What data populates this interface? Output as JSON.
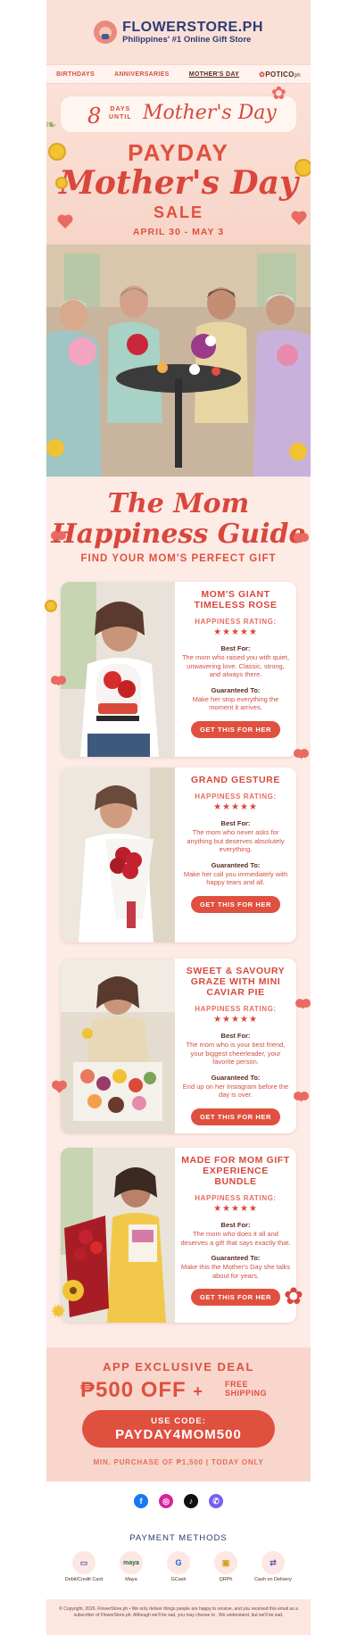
{
  "header": {
    "brand": "FLOWERSTORE.PH",
    "tagline": "Philippines' #1 Online Gift Store"
  },
  "nav": {
    "items": [
      "BIRTHDAYS",
      "ANNIVERSARIES",
      "MOTHER'S DAY"
    ],
    "potico": "POTICO",
    "potico_suffix": "ph"
  },
  "hero": {
    "countdown_number": "8",
    "countdown_unit": "DAYS",
    "countdown_until": "UNTIL",
    "countdown_script": "Mother's Day",
    "payday": "PAYDAY",
    "script": "Mother's Day",
    "sale": "SALE",
    "dates": "APRIL 30 - MAY 3"
  },
  "guide": {
    "line1": "The Mom",
    "line2": "Happiness Guide",
    "subtitle": "FIND YOUR MOM'S PERFECT GIFT"
  },
  "products": [
    {
      "title": "MOM'S GIANT TIMELESS ROSE",
      "rating_label": "HAPPINESS RATING:",
      "stars": "★★★★★",
      "best_for_label": "Best For:",
      "best_for": "The mom who raised you with quiet, unwavering love. Classic, strong, and always there.",
      "guaranteed_label": "Guaranteed To:",
      "guaranteed": "Make her stop everything the moment it arrives.",
      "cta": "GET THIS FOR HER"
    },
    {
      "title": "GRAND GESTURE",
      "rating_label": "HAPPINESS RATING:",
      "stars": "★★★★★",
      "best_for_label": "Best For:",
      "best_for": "The mom who never asks for anything but deserves absolutely everything.",
      "guaranteed_label": "Guaranteed To:",
      "guaranteed": "Make her call you immediately with happy tears and all.",
      "cta": "GET THIS FOR HER"
    },
    {
      "title": "SWEET & SAVOURY GRAZE WITH MINI CAVIAR PIE",
      "rating_label": "HAPPINESS RATING:",
      "stars": "★★★★★",
      "best_for_label": "Best For:",
      "best_for": "The mom who is your best friend, your biggest cheerleader, your favorite person.",
      "guaranteed_label": "Guaranteed To:",
      "guaranteed": "End up on her Instagram before the day is over.",
      "cta": "GET THIS FOR HER"
    },
    {
      "title": "MADE FOR MOM GIFT EXPERIENCE BUNDLE",
      "rating_label": "HAPPINESS RATING:",
      "stars": "★★★★★",
      "best_for_label": "Best For:",
      "best_for": "The mom who does it all and deserves a gift that says exactly that.",
      "guaranteed_label": "Guaranteed To:",
      "guaranteed": "Make this the Mother's Day she talks about for years.",
      "cta": "GET THIS FOR HER"
    }
  ],
  "deal": {
    "title": "APP EXCLUSIVE DEAL",
    "amount": "₱500 OFF",
    "plus": "+",
    "free_line1": "FREE",
    "free_line2": "SHIPPING",
    "code_label": "USE CODE:",
    "code": "PAYDAY4MOM500",
    "terms": "MIN. PURCHASE OF ₱1,500 | TODAY ONLY"
  },
  "footer": {
    "payment_title": "PAYMENT METHODS",
    "payments": [
      "Debit/Credit Card",
      "Maya",
      "GCash",
      "QRPh",
      "Cash on Delivery"
    ],
    "payment_glyphs": [
      "▭",
      "maya",
      "G",
      "▣",
      "⇄"
    ],
    "copyright": "© Copyright, 2026, FlowerStore.ph • We only deliver things people are happy to receive, and you received this email as a subscriber of FlowerStore.ph. Although we'll be sad, you may choose to . We understand, but we'll be sad."
  },
  "colors": {
    "accent": "#e0503f",
    "navy": "#2b3d73",
    "pink_bg": "#fdebe6"
  }
}
